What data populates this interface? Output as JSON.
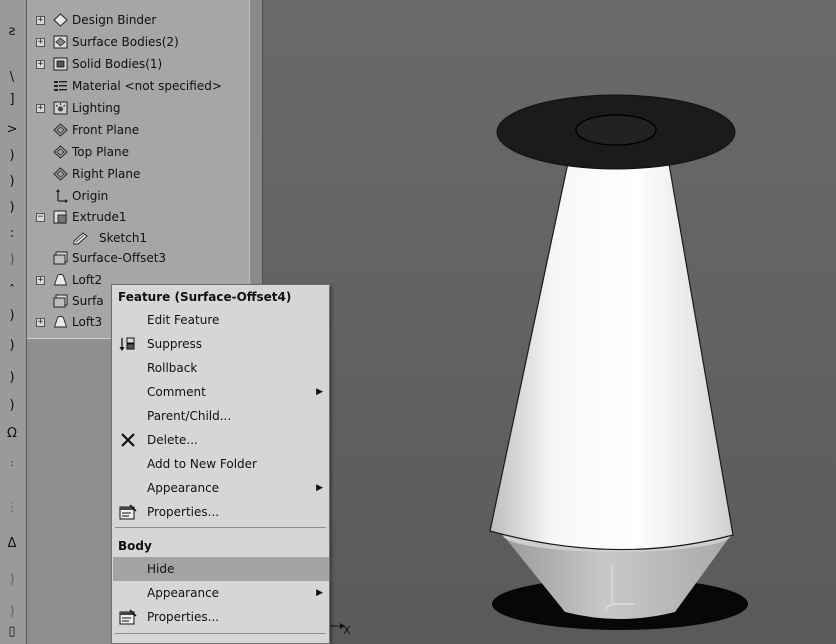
{
  "tree": {
    "items": [
      {
        "label": "Design Binder",
        "icon": "design-binder-icon",
        "expander": "+"
      },
      {
        "label": "Surface Bodies(2)",
        "icon": "surface-bodies-icon",
        "expander": "+"
      },
      {
        "label": "Solid Bodies(1)",
        "icon": "solid-bodies-icon",
        "expander": "+"
      },
      {
        "label": "Material <not specified>",
        "icon": "material-icon",
        "expander": ""
      },
      {
        "label": "Lighting",
        "icon": "lighting-icon",
        "expander": "+"
      },
      {
        "label": "Front Plane",
        "icon": "plane-icon",
        "expander": ""
      },
      {
        "label": "Top Plane",
        "icon": "plane-icon",
        "expander": ""
      },
      {
        "label": "Right Plane",
        "icon": "plane-icon",
        "expander": ""
      },
      {
        "label": "Origin",
        "icon": "origin-icon",
        "expander": ""
      },
      {
        "label": "Extrude1",
        "icon": "extrude-icon",
        "expander": "−"
      },
      {
        "label": "Sketch1",
        "icon": "sketch-icon",
        "expander": ""
      },
      {
        "label": "Surface-Offset3",
        "icon": "surface-offset-icon",
        "expander": ""
      },
      {
        "label": "Loft2",
        "icon": "loft-icon",
        "expander": "+"
      },
      {
        "label": "Surfa",
        "icon": "surface-offset-icon",
        "expander": ""
      },
      {
        "label": "Loft3",
        "icon": "loft-icon",
        "expander": "+"
      }
    ]
  },
  "context_menu": {
    "feature_header": "Feature (Surface-Offset4)",
    "feature_items": [
      {
        "label": "Edit Feature",
        "icon": "",
        "submenu": false
      },
      {
        "label": "Suppress",
        "icon": "suppress-icon",
        "submenu": false
      },
      {
        "label": "Rollback",
        "icon": "",
        "submenu": false
      },
      {
        "label": "Comment",
        "icon": "",
        "submenu": true
      },
      {
        "label": "Parent/Child...",
        "icon": "",
        "submenu": false
      },
      {
        "label": "Delete...",
        "icon": "delete-icon",
        "submenu": false
      },
      {
        "label": "Add to New Folder",
        "icon": "",
        "submenu": false
      },
      {
        "label": "Appearance",
        "icon": "",
        "submenu": true
      },
      {
        "label": "Properties...",
        "icon": "properties-icon",
        "submenu": false
      }
    ],
    "body_header": "Body",
    "body_items": [
      {
        "label": "Hide",
        "icon": "",
        "submenu": false,
        "highlighted": true
      },
      {
        "label": "Appearance",
        "icon": "",
        "submenu": true
      },
      {
        "label": "Properties...",
        "icon": "properties-icon",
        "submenu": false
      }
    ]
  },
  "viewport": {
    "axis_label": "X"
  },
  "colors": {
    "menu_bg": "#d6d6d6",
    "highlight": "#a3a3a3",
    "viewport_bg": "#606060",
    "tree_bg": "#a6a6a6"
  }
}
